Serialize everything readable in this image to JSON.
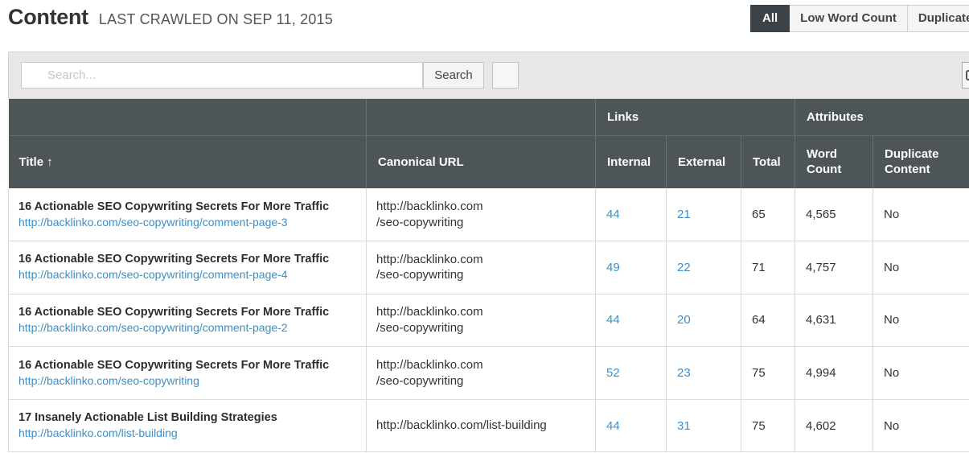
{
  "header": {
    "title": "Content",
    "crawl_label": "LAST CRAWLED ON SEP 11, 2015"
  },
  "filters": {
    "all": "All",
    "low_word_count": "Low Word Count",
    "duplicate": "Duplicate"
  },
  "toolbar": {
    "search_placeholder": "Search...",
    "search_button": "Search"
  },
  "table": {
    "groups": {
      "links": "Links",
      "attributes": "Attributes"
    },
    "columns": {
      "title": "Title",
      "sort_indicator": "↑",
      "canonical_url": "Canonical URL",
      "internal": "Internal",
      "external": "External",
      "total": "Total",
      "word_count": "Word Count",
      "duplicate_content": "Duplicate Content"
    },
    "rows": [
      {
        "title": "16 Actionable SEO Copywriting Secrets For More Traffic",
        "url": "http://backlinko.com/seo-copywriting/comment-page-3",
        "canonical_1": "http://backlinko.com",
        "canonical_2": "/seo-copywriting",
        "internal": "44",
        "external": "21",
        "total": "65",
        "word_count": "4,565",
        "duplicate": "No"
      },
      {
        "title": "16 Actionable SEO Copywriting Secrets For More Traffic",
        "url": "http://backlinko.com/seo-copywriting/comment-page-4",
        "canonical_1": "http://backlinko.com",
        "canonical_2": "/seo-copywriting",
        "internal": "49",
        "external": "22",
        "total": "71",
        "word_count": "4,757",
        "duplicate": "No"
      },
      {
        "title": "16 Actionable SEO Copywriting Secrets For More Traffic",
        "url": "http://backlinko.com/seo-copywriting/comment-page-2",
        "canonical_1": "http://backlinko.com",
        "canonical_2": "/seo-copywriting",
        "internal": "44",
        "external": "20",
        "total": "64",
        "word_count": "4,631",
        "duplicate": "No"
      },
      {
        "title": "16 Actionable SEO Copywriting Secrets For More Traffic",
        "url": "http://backlinko.com/seo-copywriting",
        "canonical_1": "http://backlinko.com",
        "canonical_2": "/seo-copywriting",
        "internal": "52",
        "external": "23",
        "total": "75",
        "word_count": "4,994",
        "duplicate": "No"
      },
      {
        "title": "17 Insanely Actionable List Building Strategies",
        "url": "http://backlinko.com/list-building",
        "canonical_1": "http://backlinko.com/list-building",
        "canonical_2": "",
        "internal": "44",
        "external": "31",
        "total": "75",
        "word_count": "4,602",
        "duplicate": "No"
      }
    ]
  }
}
